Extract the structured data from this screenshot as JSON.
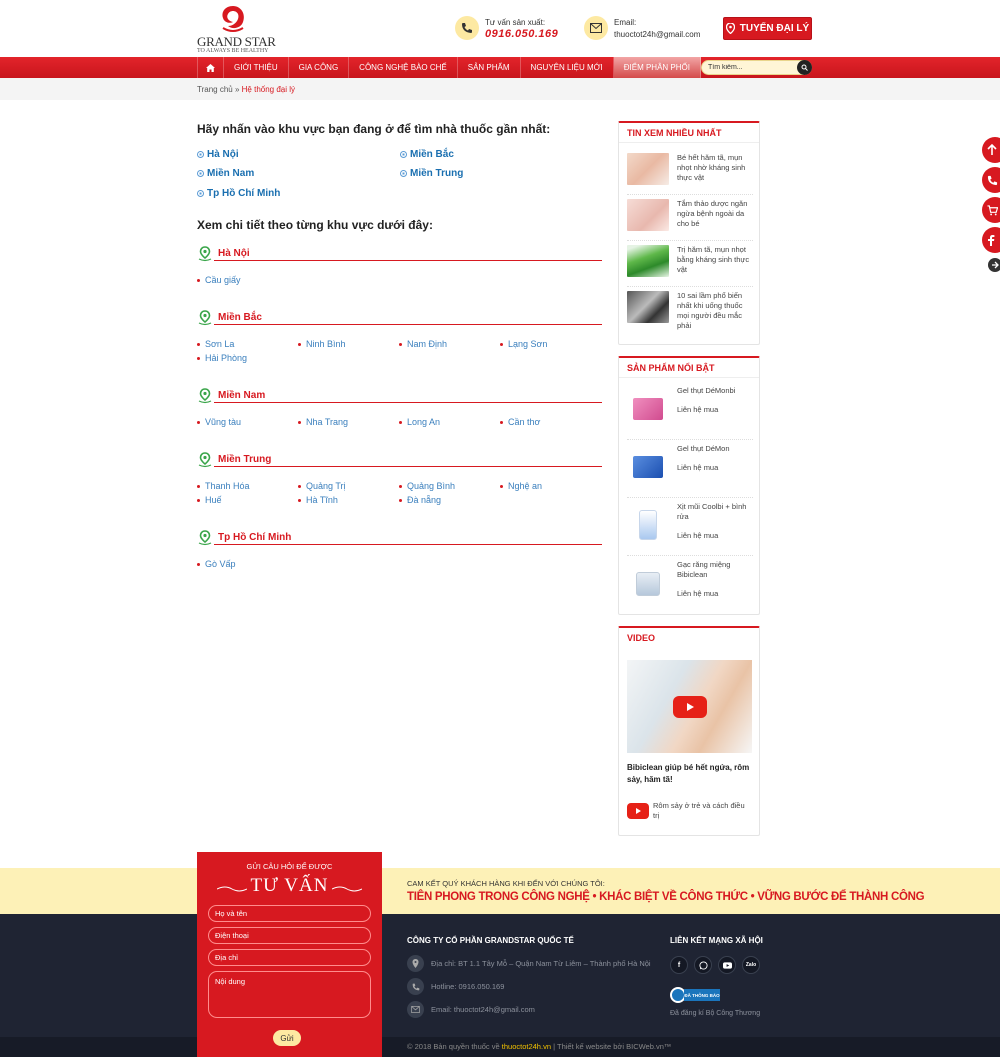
{
  "header": {
    "logo_text": "GRAND STAR",
    "logo_tagline": "TO ALWAYS BE HEALTHY",
    "hotline_label": "Tư vấn sản xuất:",
    "hotline": "0916.050.169",
    "email_label": "Email:",
    "email": "thuoctot24h@gmail.com",
    "agent_button": "TUYỂN ĐẠI LÝ"
  },
  "nav": {
    "items": [
      "GIỚI THIỆU",
      "GIA CÔNG",
      "CÔNG NGHỆ BÀO CHẾ",
      "SẢN PHẨM",
      "NGUYÊN LIỆU MỚI",
      "ĐIỂM PHÂN PHỐI"
    ],
    "active_index": 5,
    "search_placeholder": "Tìm kiếm..."
  },
  "breadcrumb": {
    "home": "Trang chủ",
    "sep": "»",
    "current": "Hệ thống đại lý"
  },
  "main": {
    "intro_title": "Hãy nhấn vào khu vực bạn đang ở để tìm nhà thuốc gần nhất:",
    "region_links": [
      "Hà Nội",
      "Miền Bắc",
      "Miền Nam",
      "Miền Trung",
      "Tp Hồ Chí Minh"
    ],
    "detail_title": "Xem chi tiết theo từng khu vực dưới đây:",
    "sections": [
      {
        "name": "Hà Nội",
        "cities": [
          "Cầu giấy"
        ]
      },
      {
        "name": "Miền Bắc",
        "cities": [
          "Sơn La",
          "Ninh Bình",
          "Nam Định",
          "Lạng Sơn",
          "Hải Phòng"
        ]
      },
      {
        "name": "Miền Nam",
        "cities": [
          "Vũng tàu",
          "Nha Trang",
          "Long An",
          "Cần thơ"
        ]
      },
      {
        "name": "Miền Trung",
        "cities": [
          "Thanh Hóa",
          "Quảng Trị",
          "Quảng Bình",
          "Nghệ an",
          "Huế",
          "Hà Tĩnh",
          "Đà nẵng"
        ]
      },
      {
        "name": "Tp Hồ Chí Minh",
        "cities": [
          "Gò Vấp"
        ]
      }
    ]
  },
  "sidebar": {
    "news_title": "TIN XEM NHIỀU NHẤT",
    "news": [
      "Bé hết hăm tã, mụn nhọt nhờ kháng sinh thực vật",
      "Tắm thảo dược ngăn ngừa bệnh ngoài da cho bé",
      "Trị hăm tã, mụn nhọt bằng kháng sinh thực vật",
      "10 sai lầm phổ biến nhất khi uống thuốc mọi người đều mắc phải"
    ],
    "products_title": "SẢN PHẨM NỔI BẬT",
    "products": [
      {
        "name": "Gel thụt DéMonbi",
        "price": "Liên hệ mua"
      },
      {
        "name": "Gel thụt DéMon",
        "price": "Liên hệ mua"
      },
      {
        "name": "Xịt mũi Coolbi + bình rửa",
        "price": "Liên hệ mua"
      },
      {
        "name": "Gạc răng miệng Bibiclean",
        "price": "Liên hệ mua"
      }
    ],
    "video_title": "VIDEO",
    "video_caption": "Bibiclean giúp bé hết ngứa, rôm sảy, hăm tã!",
    "video_item": "Rôm sảy ở trẻ và cách điều trị"
  },
  "footer": {
    "form_sub": "GỬI CÂU HỎI ĐỂ ĐƯỢC",
    "form_big": "TƯ VẤN",
    "fields": [
      "Họ và tên",
      "Điện thoại",
      "Địa chỉ",
      "Nội dung"
    ],
    "send": "Gửi",
    "commit_small": "CAM KẾT QUÝ KHÁCH HÀNG KHI ĐẾN VỚI CHÚNG TÔI:",
    "commit_big": "TIÊN PHONG TRONG CÔNG NGHỆ  •  KHÁC BIỆT VỀ CÔNG THỨC  •  VỮNG BƯỚC ĐỂ THÀNH CÔNG",
    "company": "CÔNG TY CỔ PHẦN GRANDSTAR QUỐC TẾ",
    "address": "Địa chỉ: BT 1.1 Tây Mỗ – Quận Nam Từ Liêm – Thành phố Hà Nội",
    "hotline": "Hotline: 0916.050.169",
    "email": "Email: thuoctot24h@gmail.com",
    "social_title": "LIÊN KẾT MẠNG XÃ HỘI",
    "social": [
      "f",
      "zalo-chat",
      "yt",
      "Zalo"
    ],
    "bct_badge": "ĐÃ THÔNG BÁO",
    "bct_note": "Đã đăng kí Bộ Công Thương",
    "copyright_pre": "© 2018 Bản quyền thuốc về",
    "copyright_site": "thuoctot24h.vn",
    "copyright_post": "|  Thiết kế website bởi BICWeb.vn™"
  },
  "colors": {
    "brand_red": "#d71920",
    "link_blue": "#3a7fbd",
    "footer_dark": "#1f2433",
    "cream": "#fdf1b7"
  }
}
